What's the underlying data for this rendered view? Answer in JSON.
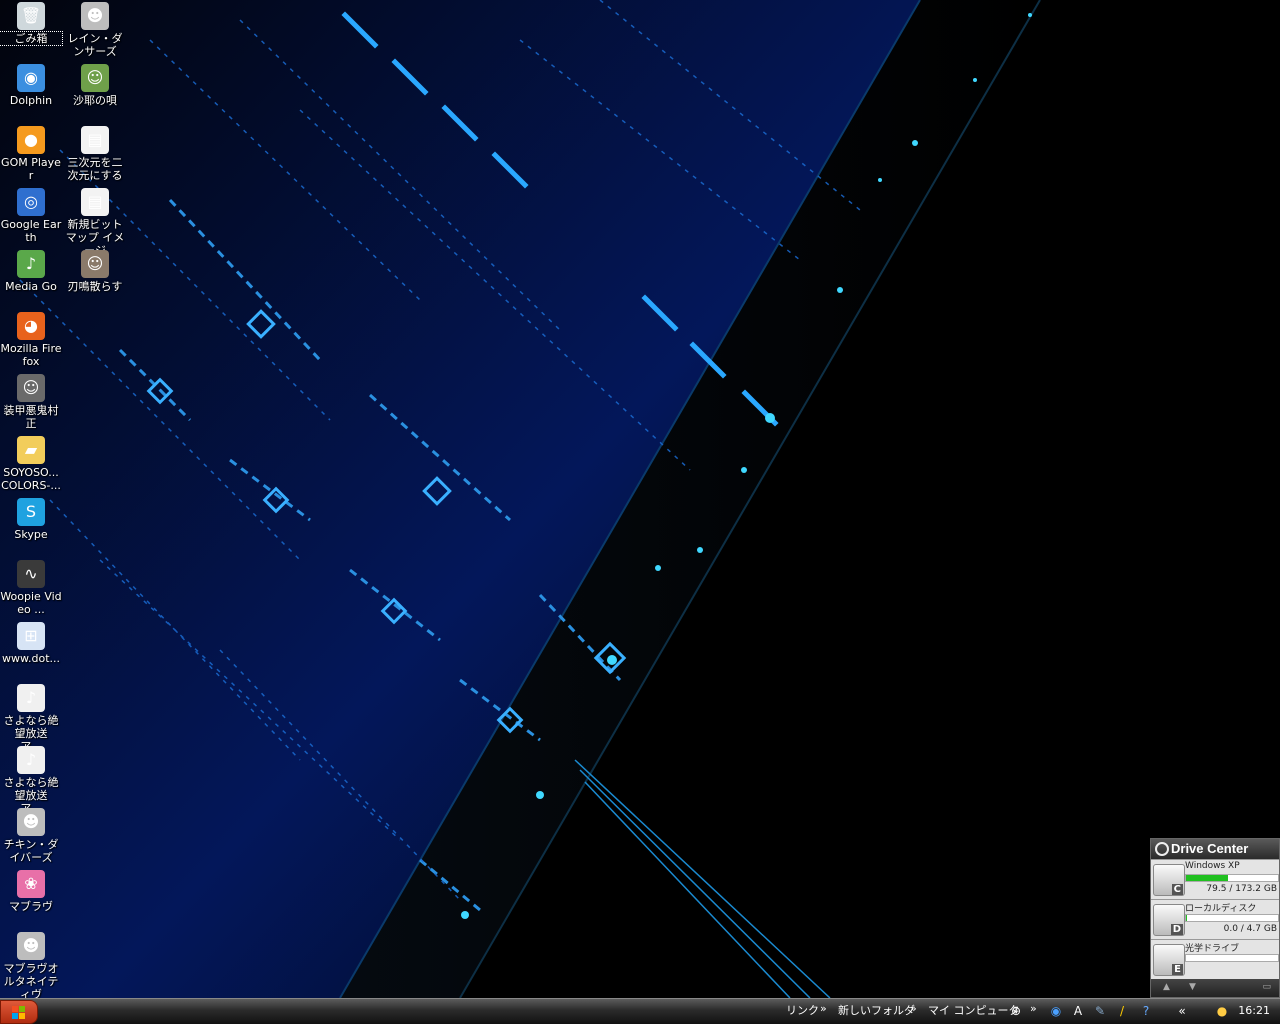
{
  "desktop": {
    "icons_left": [
      {
        "label": "ごみ箱",
        "glyph": "🗑",
        "icon": "recycle-bin-icon",
        "color": "#cfd8dc"
      },
      {
        "label": "Dolphin",
        "glyph": "◉",
        "icon": "dolphin-icon",
        "color": "#3b8fe0"
      },
      {
        "label": "GOM Player",
        "glyph": "●",
        "icon": "gom-player-icon",
        "color": "#f59a1e"
      },
      {
        "label": "Google Earth",
        "glyph": "◎",
        "icon": "google-earth-icon",
        "color": "#2f6fcf"
      },
      {
        "label": "Media Go",
        "glyph": "♪",
        "icon": "media-go-icon",
        "color": "#5aa84a"
      },
      {
        "label": "Mozilla Firefox",
        "glyph": "◕",
        "icon": "firefox-icon",
        "color": "#e8621c"
      },
      {
        "label": "装甲悪鬼村正",
        "glyph": "☺",
        "icon": "game-character-icon",
        "color": "#6a6a6a"
      },
      {
        "label": "SOYOSO... COLORS-...",
        "glyph": "▰",
        "icon": "folder-icon",
        "color": "#f2cd5b"
      },
      {
        "label": "Skype",
        "glyph": "S",
        "icon": "skype-icon",
        "color": "#1fa2e0"
      },
      {
        "label": "Woopie Video ...",
        "glyph": "∿",
        "icon": "woopie-video-icon",
        "color": "#3a3a3a"
      },
      {
        "label": "www.dot...",
        "glyph": "⊞",
        "icon": "internet-shortcut-icon",
        "color": "#d7e4f5"
      },
      {
        "label": "さよなら絶望放送　ア...",
        "glyph": "♪",
        "icon": "audio-file-icon",
        "color": "#f0f0f0"
      },
      {
        "label": "さよなら絶望放送　ア...",
        "glyph": "♪",
        "icon": "audio-file-icon",
        "color": "#f0f0f0"
      },
      {
        "label": "チキン・ダイバーズ",
        "glyph": "☻",
        "icon": "game-icon",
        "color": "#bdbdbd"
      },
      {
        "label": "マブラヴ",
        "glyph": "❀",
        "icon": "muvluv-icon",
        "color": "#e870a8"
      },
      {
        "label": "マブラヴオルタネイティヴ",
        "glyph": "☻",
        "icon": "game-icon",
        "color": "#bdbdbd"
      }
    ],
    "icons_right": [
      {
        "label": "レイン・ダンサーズ",
        "glyph": "☻",
        "icon": "game-icon",
        "color": "#bdbdbd"
      },
      {
        "label": "沙耶の唄",
        "glyph": "☺",
        "icon": "game-character-icon",
        "color": "#6fa04a"
      },
      {
        "label": "三次元を二次元にする",
        "glyph": "▤",
        "icon": "bitmap-file-icon",
        "color": "#f3f3f3"
      },
      {
        "label": "新規ビットマップ イメージ",
        "glyph": "▤",
        "icon": "bitmap-file-icon",
        "color": "#f3f3f3"
      },
      {
        "label": "刃鳴散らす",
        "glyph": "☺",
        "icon": "game-character-icon",
        "color": "#8a7a6a"
      }
    ]
  },
  "drive_center": {
    "title": "Drive Center",
    "drives": [
      {
        "letter": "C",
        "name": "Windows XP",
        "usage": "79.5 / 173.2 GB",
        "fill": 0.46
      },
      {
        "letter": "D",
        "name": "ローカルディスク",
        "usage": "0.0 / 4.7 GB",
        "fill": 0.01
      },
      {
        "letter": "E",
        "name": "光学ドライブ",
        "usage": "",
        "fill": 0
      }
    ],
    "footer_up": "▲",
    "footer_down": "▼",
    "footer_min": "▭"
  },
  "taskbar": {
    "toolbars": [
      {
        "label": "リンク"
      },
      {
        "label": "新しいフォルダ"
      },
      {
        "label": "マイ コンピュータ"
      }
    ],
    "chevron": "»",
    "tray_expand": "«",
    "clock": "16:21"
  }
}
